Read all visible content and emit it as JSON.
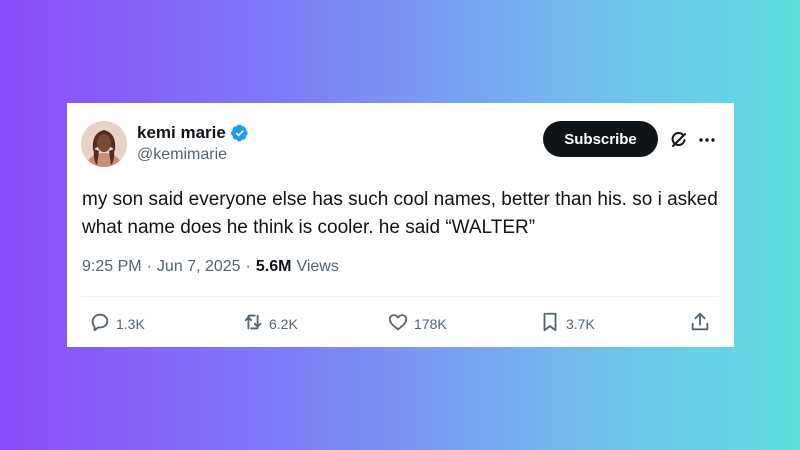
{
  "user": {
    "display_name": "kemi marie",
    "handle": "@kemimarie"
  },
  "subscribe_label": "Subscribe",
  "tweet": {
    "text": "my son said everyone else has such cool names, better than his. so i asked what name does he think is cooler. he said “WALTER”",
    "time": "9:25 PM",
    "date": "Jun 7, 2025",
    "views_count": "5.6M",
    "views_label": "Views",
    "separator": "·"
  },
  "actions": {
    "replies": "1.3K",
    "reposts": "6.2K",
    "likes": "178K",
    "bookmarks": "3.7K"
  },
  "colors": {
    "verified": "#1d9bf0",
    "text_primary": "#0f1419",
    "text_secondary": "#536471",
    "button_bg": "#0f1419"
  },
  "icons": {
    "verified": "verified-badge-icon",
    "grok": "grok-icon",
    "more": "more-icon",
    "reply": "reply-icon",
    "repost": "repost-icon",
    "like": "heart-icon",
    "bookmark": "bookmark-icon",
    "share": "share-icon"
  }
}
